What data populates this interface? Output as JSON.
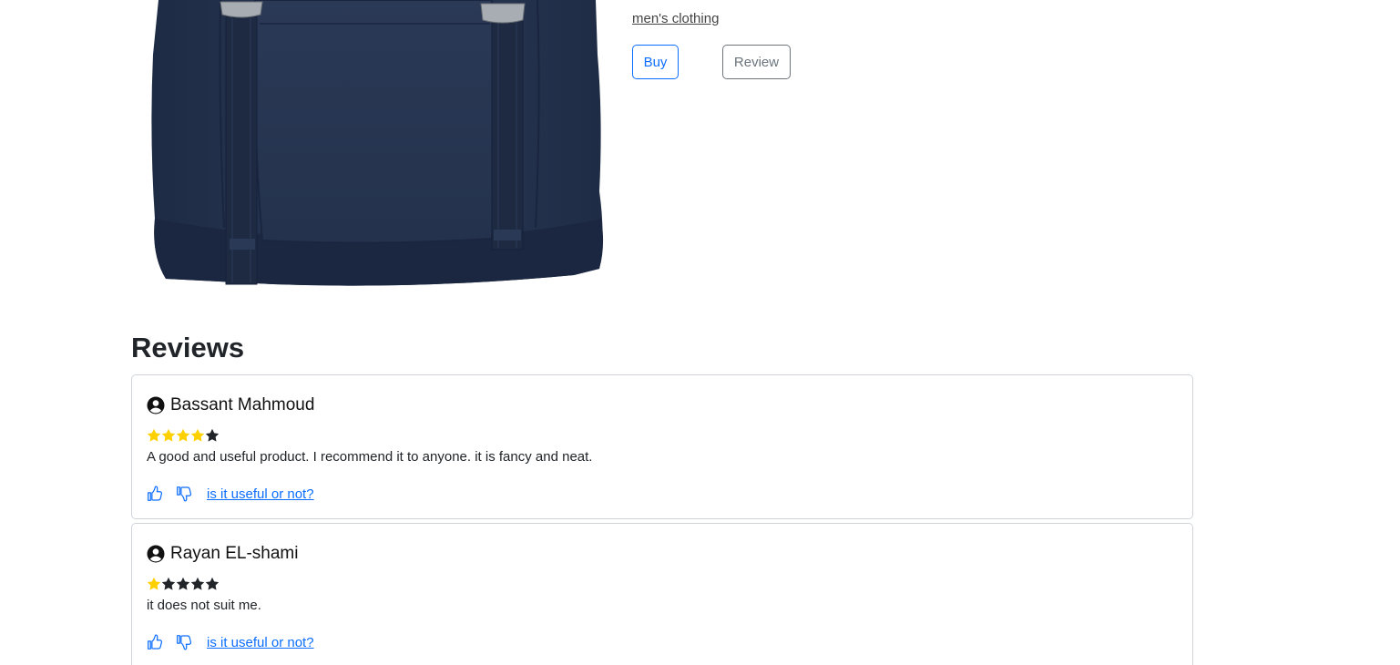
{
  "product": {
    "category": "men's clothing",
    "buy_label": "Buy",
    "review_label": "Review",
    "image_icon": "backpack-image"
  },
  "reviews": {
    "heading": "Reviews",
    "items": [
      {
        "author": "Bassant Mahmoud",
        "rating": 4,
        "max_rating": 5,
        "text": "A good and useful product. I recommend it to anyone. it is fancy and neat.",
        "useful_prompt": "is it useful or not?"
      },
      {
        "author": "Rayan EL-shami",
        "rating": 1,
        "max_rating": 5,
        "text": "it does not suit me.",
        "useful_prompt": "is it useful or not?"
      }
    ]
  },
  "colors": {
    "primary": "#0d6efd",
    "secondary": "#6c757d",
    "star_filled": "#ffd000",
    "star_empty": "#212529",
    "backpack": "#263550"
  },
  "icons": {
    "user": "user-circle-icon",
    "like": "thumbs-up-icon",
    "dislike": "thumbs-down-icon",
    "star": "star-icon"
  }
}
